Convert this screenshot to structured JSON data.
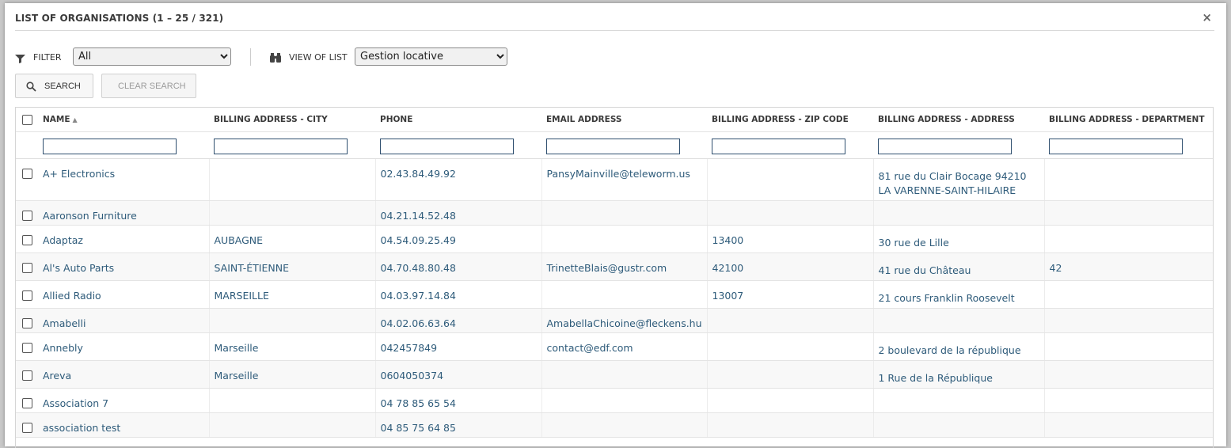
{
  "window": {
    "title": "LIST OF ORGANISATIONS (1 – 25 / 321)",
    "close_glyph": "×"
  },
  "toolbar": {
    "filter_label": "FILTER",
    "filter_value": "All",
    "filter_icon": "funnel-icon",
    "view_label": "VIEW OF LIST",
    "view_value": "Gestion locative",
    "view_icon": "binoculars-icon",
    "search_label": "SEARCH",
    "search_icon": "magnifier-icon",
    "clear_label": "CLEAR SEARCH"
  },
  "table": {
    "sort_glyph": "▲",
    "columns": [
      "NAME",
      "BILLING ADDRESS - CITY",
      "PHONE",
      "EMAIL ADDRESS",
      "BILLING ADDRESS - ZIP CODE",
      "BILLING ADDRESS - ADDRESS",
      "BILLING ADDRESS - DEPARTMENT"
    ],
    "rows": [
      {
        "name": "A+ Electronics",
        "city": "",
        "phone": "02.43.84.49.92",
        "email": "PansyMainville@teleworm.us",
        "zip": "",
        "address": "81 rue du Clair Bocage 94210 LA VARENNE-SAINT-HILAIRE",
        "department": ""
      },
      {
        "name": "Aaronson Furniture",
        "city": "",
        "phone": "04.21.14.52.48",
        "email": "",
        "zip": "",
        "address": "",
        "department": ""
      },
      {
        "name": "Adaptaz",
        "city": "AUBAGNE",
        "phone": "04.54.09.25.49",
        "email": "",
        "zip": "13400",
        "address": "30 rue de Lille",
        "department": ""
      },
      {
        "name": "Al's Auto Parts",
        "city": "SAINT-ÉTIENNE",
        "phone": "04.70.48.80.48",
        "email": "TrinetteBlais@gustr.com",
        "zip": "42100",
        "address": "41 rue du Château",
        "department": "42"
      },
      {
        "name": "Allied Radio",
        "city": "MARSEILLE",
        "phone": "04.03.97.14.84",
        "email": "",
        "zip": "13007",
        "address": "21 cours Franklin Roosevelt",
        "department": ""
      },
      {
        "name": "Amabelli",
        "city": "",
        "phone": "04.02.06.63.64",
        "email": "AmabellaChicoine@fleckens.hu",
        "zip": "",
        "address": "",
        "department": ""
      },
      {
        "name": "Annebly",
        "city": "Marseille",
        "phone": "042457849",
        "email": "contact@edf.com",
        "zip": "",
        "address": "2 boulevard de la république",
        "department": ""
      },
      {
        "name": "Areva",
        "city": "Marseille",
        "phone": "0604050374",
        "email": "",
        "zip": "",
        "address": "1 Rue de la République",
        "department": ""
      },
      {
        "name": "Association 7",
        "city": "",
        "phone": "04 78 85 65 54",
        "email": "",
        "zip": "",
        "address": "",
        "department": ""
      },
      {
        "name": "association test",
        "city": "",
        "phone": "04 85 75 64 85",
        "email": "",
        "zip": "",
        "address": "",
        "department": ""
      }
    ]
  }
}
